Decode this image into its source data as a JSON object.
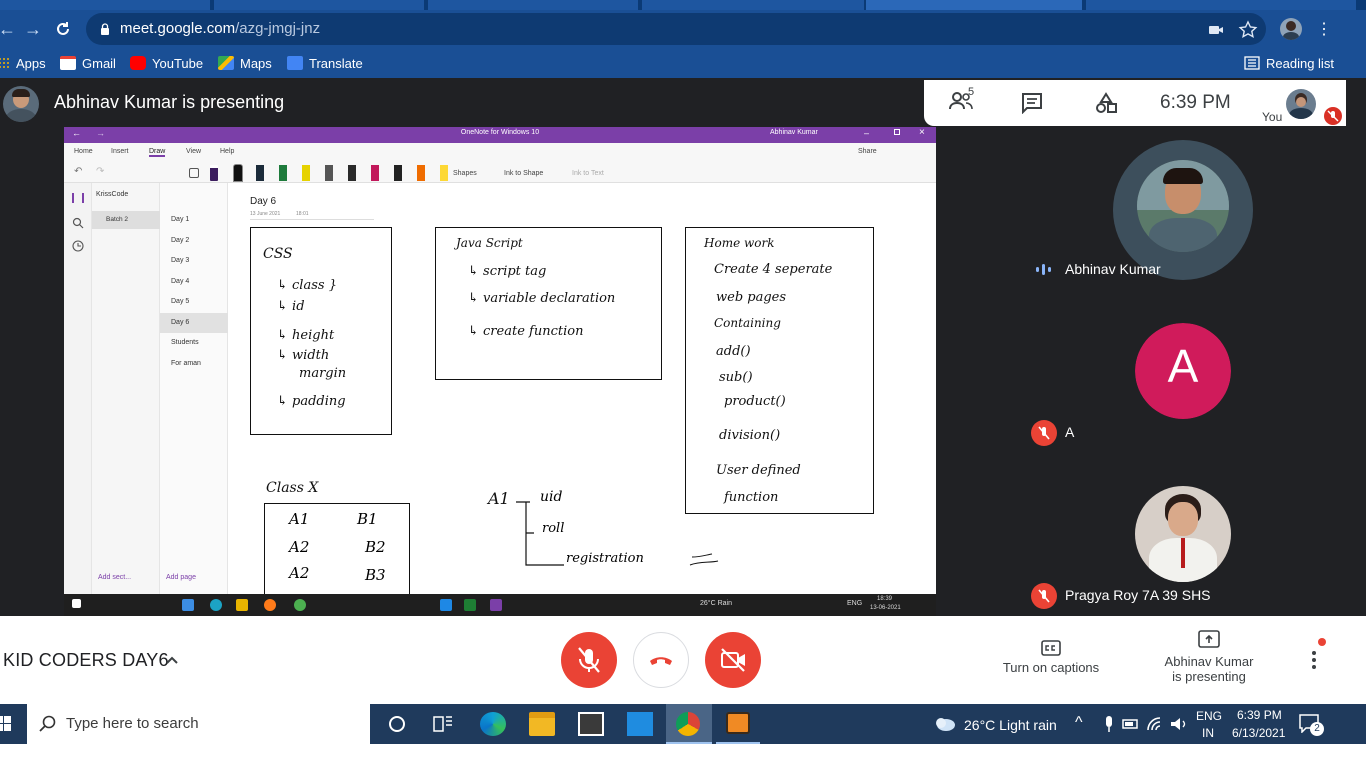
{
  "browser": {
    "url_host": "meet.google.com",
    "url_path": "/azg-jmgj-jnz",
    "bookmarks": [
      {
        "label": "Apps",
        "icon": "apps-grid-icon"
      },
      {
        "label": "Gmail",
        "icon": "gmail-icon"
      },
      {
        "label": "YouTube",
        "icon": "youtube-icon"
      },
      {
        "label": "Maps",
        "icon": "maps-icon"
      },
      {
        "label": "Translate",
        "icon": "translate-icon"
      }
    ],
    "reading_list": "Reading list"
  },
  "meet": {
    "presenting_banner": "Abhinav Kumar is presenting",
    "participant_count": "5",
    "time": "6:39 PM",
    "you_label": "You",
    "meeting_name": "KID CODERS DAY6",
    "captions_label": "Turn on captions",
    "presenting_label_1": "Abhinav Kumar",
    "presenting_label_2": "is presenting",
    "participants": [
      {
        "name": "Abhinav Kumar",
        "speaking": true
      },
      {
        "name": "A",
        "initial": "A",
        "muted": true,
        "color": "#d01b5b"
      },
      {
        "name": "Pragya Roy 7A 39 SHS",
        "muted": true
      }
    ]
  },
  "onenote": {
    "window_title": "OneNote for Windows 10",
    "user": "Abhinav Kumar",
    "tabs": [
      "Home",
      "Insert",
      "Draw",
      "View",
      "Help"
    ],
    "active_tab": "Draw",
    "share_label": "Share",
    "tools": [
      "Shapes",
      "Ink to Shape",
      "Ink to Text"
    ],
    "notebook": "KrissCode",
    "sections": [
      "Batch 2"
    ],
    "pages": [
      "Day 1",
      "Day 2",
      "Day 3",
      "Day 4",
      "Day 5",
      "Day 6",
      "Students",
      "For aman"
    ],
    "selected_page": "Day 6",
    "add_section": "Add sect...",
    "add_page": "Add page",
    "page_title": "Day 6",
    "page_date": "13 June 2021",
    "page_time": "18:01",
    "ink": {
      "css_box": [
        "CSS",
        "class",
        "id",
        "height",
        "width",
        "margin",
        "padding"
      ],
      "js_box": [
        "Java Script",
        "script tag",
        "variable declaration",
        "create function"
      ],
      "homework_box": [
        "Home work",
        "Create 4 seperate",
        "web pages",
        "Containing",
        "add()",
        "sub()",
        "product()",
        "division()",
        "User defined",
        "function"
      ],
      "class_table_title": "Class X",
      "class_table": [
        [
          "A1",
          "B1"
        ],
        [
          "A2",
          "B2"
        ],
        [
          "A2",
          "B3"
        ]
      ],
      "tree_root": "A1",
      "tree_items": [
        "uid",
        "roll",
        "registration"
      ]
    },
    "inner_taskbar": {
      "weather": "26°C Rain",
      "lang": "ENG",
      "time": "18:39",
      "date": "13-06-2021"
    }
  },
  "windows_taskbar": {
    "search_placeholder": "Type here to search",
    "weather": "26°C  Light rain",
    "lang_1": "ENG",
    "lang_2": "IN",
    "time": "6:39 PM",
    "date": "6/13/2021",
    "notifications": "2"
  }
}
